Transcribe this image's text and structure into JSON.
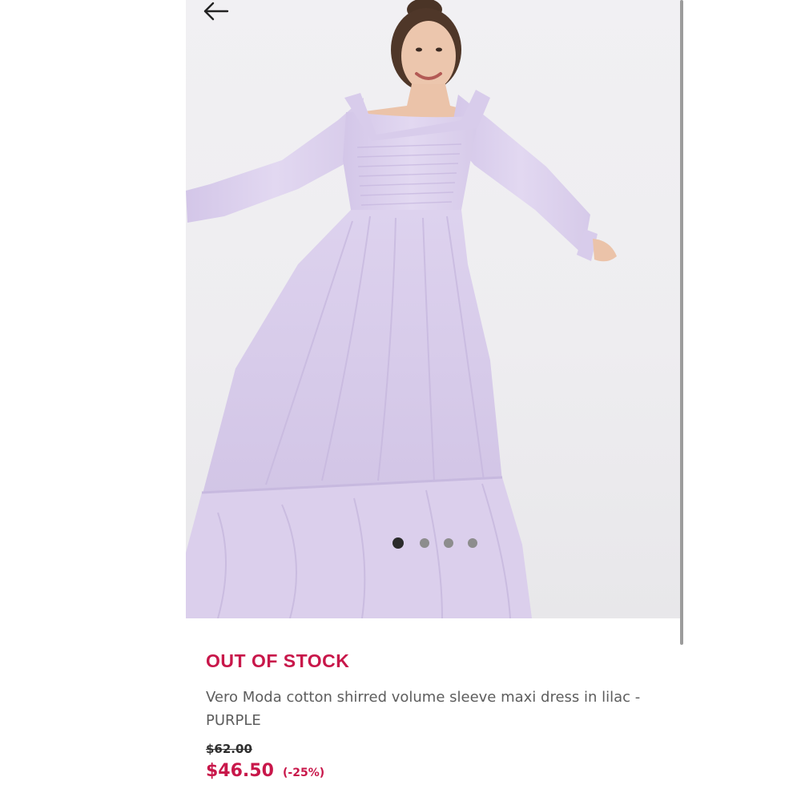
{
  "navigation": {
    "back_icon": "arrow-left-icon"
  },
  "gallery": {
    "image_count": 4,
    "active_index": 0
  },
  "product": {
    "stock_status": "OUT OF STOCK",
    "title": "Vero Moda cotton shirred volume sleeve maxi dress in lilac - PURPLE",
    "original_price": "$62.00",
    "sale_price": "$46.50",
    "discount": "(-25%)"
  },
  "colors": {
    "accent": "#c8174a",
    "dress": "#ddd2ee",
    "background": "#ffffff"
  }
}
